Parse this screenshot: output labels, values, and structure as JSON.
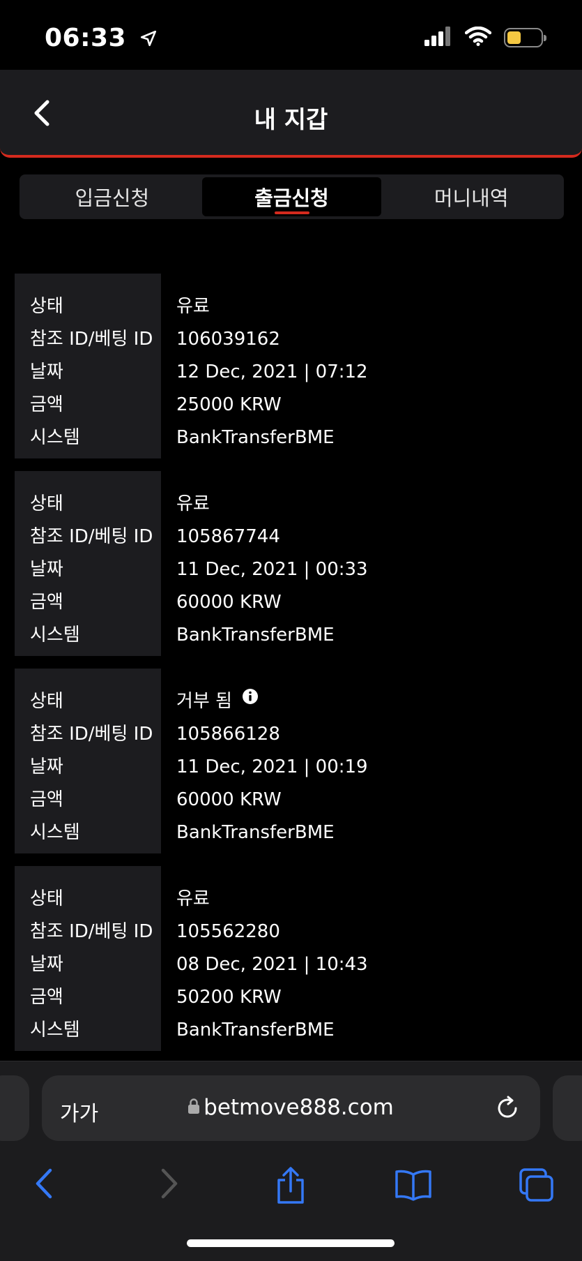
{
  "status_bar": {
    "time": "06:33"
  },
  "header": {
    "title": "내 지갑"
  },
  "tabs": [
    {
      "label": "입금신청",
      "active": false
    },
    {
      "label": "출금신청",
      "active": true
    },
    {
      "label": "머니내역",
      "active": false
    }
  ],
  "labels": {
    "status": "상태",
    "ref_id": "참조 ID/베팅 ID",
    "date": "날짜",
    "amount": "금액",
    "system": "시스템"
  },
  "records": [
    {
      "status": "유료",
      "ref_id": "106039162",
      "date": "12 Dec, 2021 | 07:12",
      "amount": "25000 KRW",
      "system": "BankTransferBME"
    },
    {
      "status": "유료",
      "ref_id": "105867744",
      "date": "11 Dec, 2021 | 00:33",
      "amount": "60000 KRW",
      "system": "BankTransferBME"
    },
    {
      "status": "거부 됨",
      "ref_id": "105866128",
      "date": "11 Dec, 2021 | 00:19",
      "amount": "60000 KRW",
      "system": "BankTransferBME"
    },
    {
      "status": "유료",
      "ref_id": "105562280",
      "date": "08 Dec, 2021 | 10:43",
      "amount": "50200 KRW",
      "system": "BankTransferBME"
    }
  ],
  "browser": {
    "text_size_label": "가가",
    "url": "betmove888.com"
  },
  "colors": {
    "accent": "#d42a1e",
    "panel": "#1c1c1f",
    "ios_blue": "#3478f6"
  }
}
